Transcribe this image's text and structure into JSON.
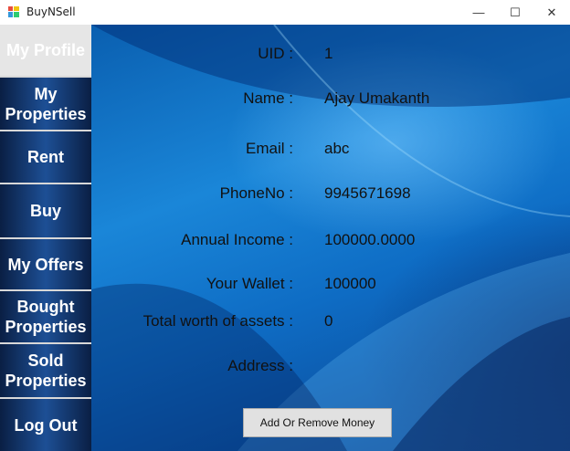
{
  "window": {
    "title": "BuyNSell",
    "minimize_glyph": "—",
    "maximize_glyph": "☐",
    "close_glyph": "✕"
  },
  "sidebar": {
    "items": [
      {
        "label": "My Profile",
        "active": true
      },
      {
        "label": "My Properties",
        "active": false
      },
      {
        "label": "Rent",
        "active": false
      },
      {
        "label": "Buy",
        "active": false
      },
      {
        "label": "My Offers",
        "active": false
      },
      {
        "label": "Bought Properties",
        "active": false
      },
      {
        "label": "Sold Properties",
        "active": false
      },
      {
        "label": "Log Out",
        "active": false
      }
    ]
  },
  "profile": {
    "fields": [
      {
        "label": "UID :",
        "value": "1"
      },
      {
        "label": "Name :",
        "value": "Ajay Umakanth"
      },
      {
        "label": "Email :",
        "value": "abc"
      },
      {
        "label": "PhoneNo :",
        "value": "9945671698"
      },
      {
        "label": "Annual Income :",
        "value": "100000.0000"
      },
      {
        "label": "Your Wallet :",
        "value": "100000"
      },
      {
        "label": "Total worth of assets :",
        "value": "0"
      },
      {
        "label": "Address :",
        "value": ""
      }
    ],
    "add_money_button": "Add Or Remove Money"
  },
  "colors": {
    "sidebar_bg": "#0a2a5a",
    "content_bg": "#1a86d8",
    "active_item_bg": "#e6e6e6",
    "button_bg": "#e1e1e1"
  }
}
